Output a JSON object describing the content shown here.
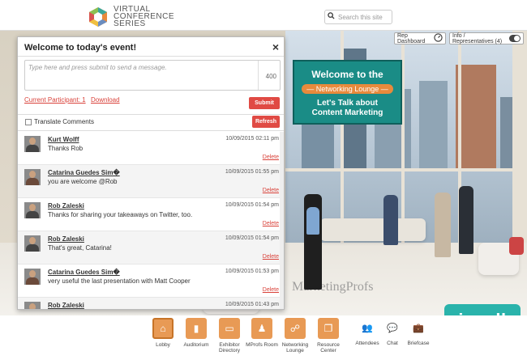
{
  "header": {
    "logo_lines": [
      "VIRTUAL",
      "CONFERENCE",
      "SERIES"
    ],
    "search_placeholder": "Search this site"
  },
  "topright": {
    "rep_dashboard": "Rep Dashboard",
    "info_reps": "Info / Representatives (4)"
  },
  "sign": {
    "line1": "Welcome to the",
    "pill": "— Networking Lounge —",
    "line3a": "Let's Talk about",
    "line3b": "Content Marketing"
  },
  "watermark": "MarketingProfs",
  "brand_badge": "visually",
  "panel": {
    "title": "Welcome to today's event!",
    "close": "×",
    "message_placeholder": "Type here and press submit to send a message.",
    "char_count": "400",
    "current_participant": "Current Participant: 1",
    "download": "Download",
    "submit": "Submit",
    "translate": "Translate Comments",
    "refresh": "Refresh",
    "delete_label": "Delete",
    "messages": [
      {
        "name": "Kurt Wolff",
        "text": "Thanks Rob",
        "time": "10/09/2015 02:11 pm"
      },
      {
        "name": "Catarina Guedes Sim�",
        "text": "you are welcome @Rob",
        "time": "10/09/2015 01:55 pm"
      },
      {
        "name": "Rob Zaleski",
        "text": "Thanks for sharing your takeaways on Twitter, too.",
        "time": "10/09/2015 01:54 pm"
      },
      {
        "name": "Rob Zaleski",
        "text": "That's great, Catarina!",
        "time": "10/09/2015 01:54 pm"
      },
      {
        "name": "Catarina Guedes Sim�",
        "text": "very useful the last presentation with Matt Cooper",
        "time": "10/09/2015 01:53 pm"
      },
      {
        "name": "Rob Zaleski",
        "text": "",
        "time": "10/09/2015 01:43 pm"
      }
    ]
  },
  "nav": {
    "lobby": "Lobby",
    "auditorium": "Auditorium",
    "exhibitor1": "Exhibitor",
    "exhibitor2": "Directory",
    "mprofs": "MProfs Room",
    "networking1": "Networking",
    "networking2": "Lounge",
    "resource1": "Resource",
    "resource2": "Center",
    "attendees": "Attendees",
    "chat": "Chat",
    "briefcase": "Briefcase"
  }
}
